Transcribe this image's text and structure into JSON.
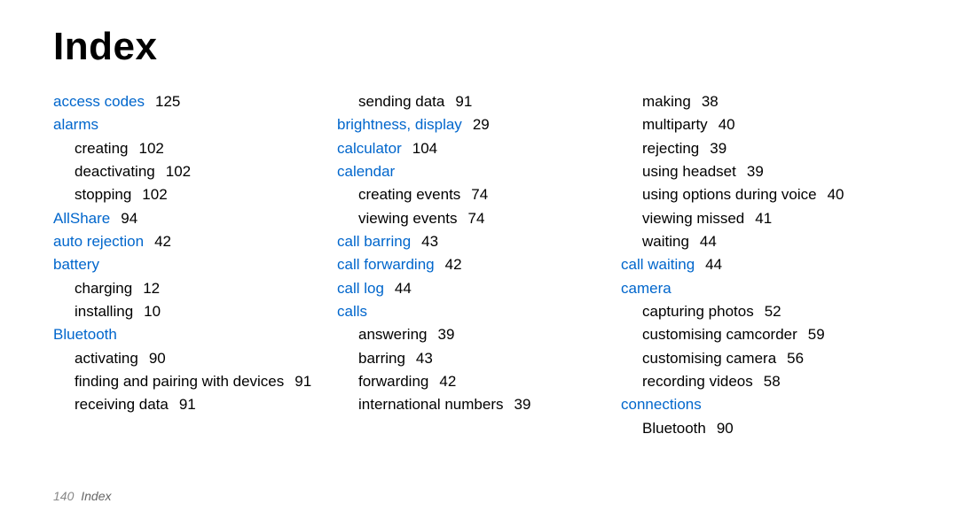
{
  "title": "Index",
  "footer": {
    "page": "140",
    "section": "Index"
  },
  "columns": [
    [
      {
        "type": "term",
        "label": "access codes",
        "page": "125"
      },
      {
        "type": "term",
        "label": "alarms"
      },
      {
        "type": "sub",
        "label": "creating",
        "page": "102"
      },
      {
        "type": "sub",
        "label": "deactivating",
        "page": "102"
      },
      {
        "type": "sub",
        "label": "stopping",
        "page": "102"
      },
      {
        "type": "term",
        "label": "AllShare",
        "page": "94"
      },
      {
        "type": "term",
        "label": "auto rejection",
        "page": "42"
      },
      {
        "type": "term",
        "label": "battery"
      },
      {
        "type": "sub",
        "label": "charging",
        "page": "12"
      },
      {
        "type": "sub",
        "label": "installing",
        "page": "10"
      },
      {
        "type": "term",
        "label": "Bluetooth"
      },
      {
        "type": "sub",
        "label": "activating",
        "page": "90"
      },
      {
        "type": "sub",
        "label": "finding and pairing with devices",
        "page": "91"
      },
      {
        "type": "sub",
        "label": "receiving data",
        "page": "91"
      }
    ],
    [
      {
        "type": "sub",
        "label": "sending data",
        "page": "91"
      },
      {
        "type": "term",
        "label": "brightness, display",
        "page": "29"
      },
      {
        "type": "term",
        "label": "calculator",
        "page": "104"
      },
      {
        "type": "term",
        "label": "calendar"
      },
      {
        "type": "sub",
        "label": "creating events",
        "page": "74"
      },
      {
        "type": "sub",
        "label": "viewing events",
        "page": "74"
      },
      {
        "type": "term",
        "label": "call barring",
        "page": "43"
      },
      {
        "type": "term",
        "label": "call forwarding",
        "page": "42"
      },
      {
        "type": "term",
        "label": "call log",
        "page": "44"
      },
      {
        "type": "term",
        "label": "calls"
      },
      {
        "type": "sub",
        "label": "answering",
        "page": "39"
      },
      {
        "type": "sub",
        "label": "barring",
        "page": "43"
      },
      {
        "type": "sub",
        "label": "forwarding",
        "page": "42"
      },
      {
        "type": "sub",
        "label": "international numbers",
        "page": "39"
      }
    ],
    [
      {
        "type": "sub",
        "label": "making",
        "page": "38"
      },
      {
        "type": "sub",
        "label": "multiparty",
        "page": "40"
      },
      {
        "type": "sub",
        "label": "rejecting",
        "page": "39"
      },
      {
        "type": "sub",
        "label": "using headset",
        "page": "39"
      },
      {
        "type": "sub",
        "label": "using options during voice",
        "page": "40"
      },
      {
        "type": "sub",
        "label": "viewing missed",
        "page": "41"
      },
      {
        "type": "sub",
        "label": "waiting",
        "page": "44"
      },
      {
        "type": "term",
        "label": "call waiting",
        "page": "44"
      },
      {
        "type": "term",
        "label": "camera"
      },
      {
        "type": "sub",
        "label": "capturing photos",
        "page": "52"
      },
      {
        "type": "sub",
        "label": "customising camcorder",
        "page": "59"
      },
      {
        "type": "sub",
        "label": "customising camera",
        "page": "56"
      },
      {
        "type": "sub",
        "label": "recording videos",
        "page": "58"
      },
      {
        "type": "term",
        "label": "connections"
      },
      {
        "type": "sub",
        "label": "Bluetooth",
        "page": "90"
      }
    ]
  ]
}
